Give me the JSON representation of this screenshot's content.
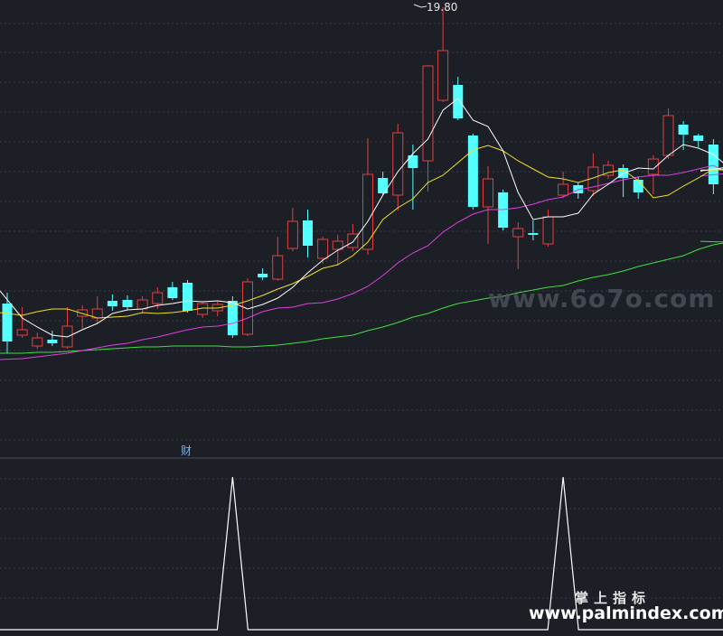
{
  "labels": {
    "peak_label": "19.80",
    "indicator_marker": "财",
    "watermark_site": "www.6o7o.com",
    "watermark_brand": "掌上指标",
    "watermark_url": "www.palmindex.com"
  },
  "colors": {
    "background": "#1c1f26",
    "grid": "#3a3e4a",
    "up_candle": "#e04040",
    "down_candle": "#54ffff",
    "ma_short": "#ffffff",
    "ma_mid": "#f0e020",
    "ma_long": "#e040e0",
    "ma_slow": "#40e040",
    "signal_line": "#ffffff"
  },
  "chart_data": [
    {
      "type": "candlestick",
      "y_max": 19.8,
      "candles": [
        {
          "o": 336,
          "c": 378,
          "h": 324,
          "l": 391
        },
        {
          "o": 371,
          "c": 365,
          "h": 340,
          "l": 374
        },
        {
          "o": 383,
          "c": 374,
          "h": 368,
          "l": 386
        },
        {
          "o": 376,
          "c": 380,
          "h": 366,
          "l": 383
        },
        {
          "o": 384,
          "c": 361,
          "h": 340,
          "l": 386
        },
        {
          "o": 350,
          "c": 343,
          "h": 338,
          "l": 364
        },
        {
          "o": 352,
          "c": 342,
          "h": 328,
          "l": 358
        },
        {
          "o": 333,
          "c": 339,
          "h": 326,
          "l": 344
        },
        {
          "o": 332,
          "c": 340,
          "h": 327,
          "l": 343
        },
        {
          "o": 342,
          "c": 332,
          "h": 328,
          "l": 347
        },
        {
          "o": 336,
          "c": 324,
          "h": 318,
          "l": 342
        },
        {
          "o": 318,
          "c": 330,
          "h": 312,
          "l": 332
        },
        {
          "o": 313,
          "c": 344,
          "h": 310,
          "l": 346
        },
        {
          "o": 348,
          "c": 336,
          "h": 334,
          "l": 352
        },
        {
          "o": 344,
          "c": 337,
          "h": 334,
          "l": 350
        },
        {
          "o": 333,
          "c": 371,
          "h": 328,
          "l": 374
        },
        {
          "o": 370,
          "c": 312,
          "h": 308,
          "l": 372
        },
        {
          "o": 303,
          "c": 307,
          "h": 297,
          "l": 310
        },
        {
          "o": 309,
          "c": 283,
          "h": 262,
          "l": 311
        },
        {
          "o": 275,
          "c": 245,
          "h": 230,
          "l": 278
        },
        {
          "o": 244,
          "c": 272,
          "h": 232,
          "l": 285
        },
        {
          "o": 286,
          "c": 265,
          "h": 262,
          "l": 292
        },
        {
          "o": 276,
          "c": 267,
          "h": 260,
          "l": 294
        },
        {
          "o": 274,
          "c": 259,
          "h": 248,
          "l": 278
        },
        {
          "o": 276,
          "c": 193,
          "h": 153,
          "l": 282
        },
        {
          "o": 197,
          "c": 214,
          "h": 190,
          "l": 216
        },
        {
          "o": 216,
          "c": 147,
          "h": 137,
          "l": 233
        },
        {
          "o": 172,
          "c": 186,
          "h": 160,
          "l": 232
        },
        {
          "o": 178,
          "c": 73,
          "h": 72,
          "l": 212
        },
        {
          "o": 111,
          "c": 56,
          "h": 8,
          "l": 113
        },
        {
          "o": 94,
          "c": 131,
          "h": 85,
          "l": 133
        },
        {
          "o": 150,
          "c": 229,
          "h": 148,
          "l": 232
        },
        {
          "o": 229,
          "c": 198,
          "h": 184,
          "l": 270
        },
        {
          "o": 213,
          "c": 252,
          "h": 210,
          "l": 255
        },
        {
          "o": 262,
          "c": 253,
          "h": 246,
          "l": 298
        },
        {
          "o": 258,
          "c": 260,
          "h": 244,
          "l": 266
        },
        {
          "o": 270,
          "c": 240,
          "h": 232,
          "l": 273
        },
        {
          "o": 216,
          "c": 204,
          "h": 190,
          "l": 219
        },
        {
          "o": 205,
          "c": 214,
          "h": 202,
          "l": 220
        },
        {
          "o": 211,
          "c": 185,
          "h": 170,
          "l": 217
        },
        {
          "o": 194,
          "c": 183,
          "h": 178,
          "l": 198
        },
        {
          "o": 186,
          "c": 197,
          "h": 182,
          "l": 218
        },
        {
          "o": 199,
          "c": 213,
          "h": 195,
          "l": 220
        },
        {
          "o": 193,
          "c": 176,
          "h": 172,
          "l": 215
        },
        {
          "o": 172,
          "c": 128,
          "h": 120,
          "l": 176
        },
        {
          "o": 138,
          "c": 149,
          "h": 134,
          "l": 166
        },
        {
          "o": 150,
          "c": 156,
          "h": 148,
          "l": 163
        },
        {
          "o": 160,
          "c": 204,
          "h": 154,
          "l": 215
        },
        {
          "o": 215,
          "c": 256,
          "h": 212,
          "l": 262
        }
      ],
      "ma_short": [
        322,
        352,
        362,
        371,
        373,
        365,
        358,
        347,
        343,
        342,
        338,
        336,
        333,
        334,
        333,
        335,
        342,
        337,
        330,
        318,
        302,
        288,
        277,
        268,
        245,
        216,
        190,
        170,
        154,
        122,
        109,
        133,
        140,
        167,
        213,
        243,
        240,
        240,
        236,
        215,
        204,
        192,
        186,
        187,
        172,
        160,
        164,
        171,
        185
      ],
      "ma_mid": [
        346,
        349,
        345,
        342,
        342,
        347,
        352,
        351,
        350,
        346,
        347,
        346,
        344,
        341,
        341,
        338,
        333,
        327,
        320,
        314,
        306,
        297,
        293,
        283,
        268,
        243,
        230,
        220,
        202,
        194,
        180,
        166,
        161,
        167,
        178,
        187,
        196,
        198,
        202,
        197,
        191,
        188,
        200,
        219,
        216,
        206,
        197,
        187,
        188
      ],
      "ma_long": [
        398,
        397,
        395,
        393,
        391,
        388,
        385,
        382,
        380,
        376,
        373,
        369,
        365,
        362,
        361,
        358,
        352,
        345,
        341,
        340,
        336,
        335,
        331,
        325,
        317,
        305,
        291,
        280,
        272,
        257,
        246,
        237,
        232,
        232,
        230,
        226,
        221,
        218,
        210,
        207,
        203,
        199,
        196,
        194,
        194,
        191,
        187,
        183,
        192
      ],
      "ma_slow": [
        391,
        391,
        390,
        390,
        389,
        388,
        387,
        386,
        385,
        384,
        384,
        383,
        383,
        383,
        383,
        384,
        384,
        383,
        382,
        380,
        378,
        375,
        373,
        371,
        366,
        362,
        357,
        351,
        347,
        341,
        336,
        333,
        330,
        328,
        324,
        321,
        318,
        316,
        311,
        307,
        304,
        300,
        295,
        291,
        287,
        283,
        276,
        271,
        268
      ],
      "signal": [
        0,
        0,
        0,
        0,
        0,
        0,
        0,
        0,
        0,
        0,
        0,
        0,
        0,
        0,
        0,
        1,
        0,
        0,
        0,
        0,
        0,
        0,
        0,
        0,
        0,
        0,
        0,
        0,
        0,
        0,
        0,
        0,
        0,
        0,
        0,
        0,
        0,
        1,
        0,
        0,
        0,
        0,
        0,
        0,
        0,
        0,
        0,
        0,
        0
      ]
    }
  ]
}
